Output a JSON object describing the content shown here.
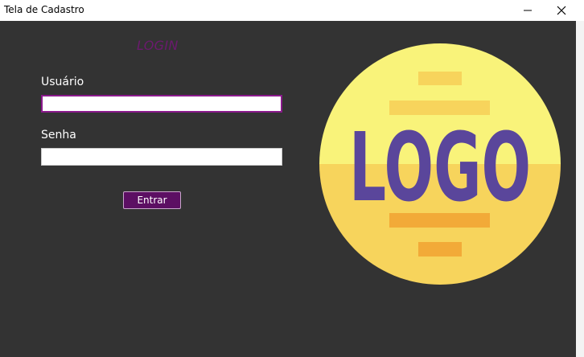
{
  "window": {
    "title": "Tela de Cadastro",
    "minimize_icon": "minimize-icon",
    "close_icon": "close-icon"
  },
  "form": {
    "heading": "LOGIN",
    "username_label": "Usuário",
    "username_value": "",
    "password_label": "Senha",
    "password_value": "",
    "submit_label": "Entrar"
  },
  "logo": {
    "text": "LOGO"
  },
  "colors": {
    "background": "#333333",
    "accent": "#5c0f63",
    "logo_yellow_light": "#f9f37a",
    "logo_yellow": "#f7d45c",
    "logo_orange": "#f2aa38",
    "logo_purple": "#5a469b"
  }
}
